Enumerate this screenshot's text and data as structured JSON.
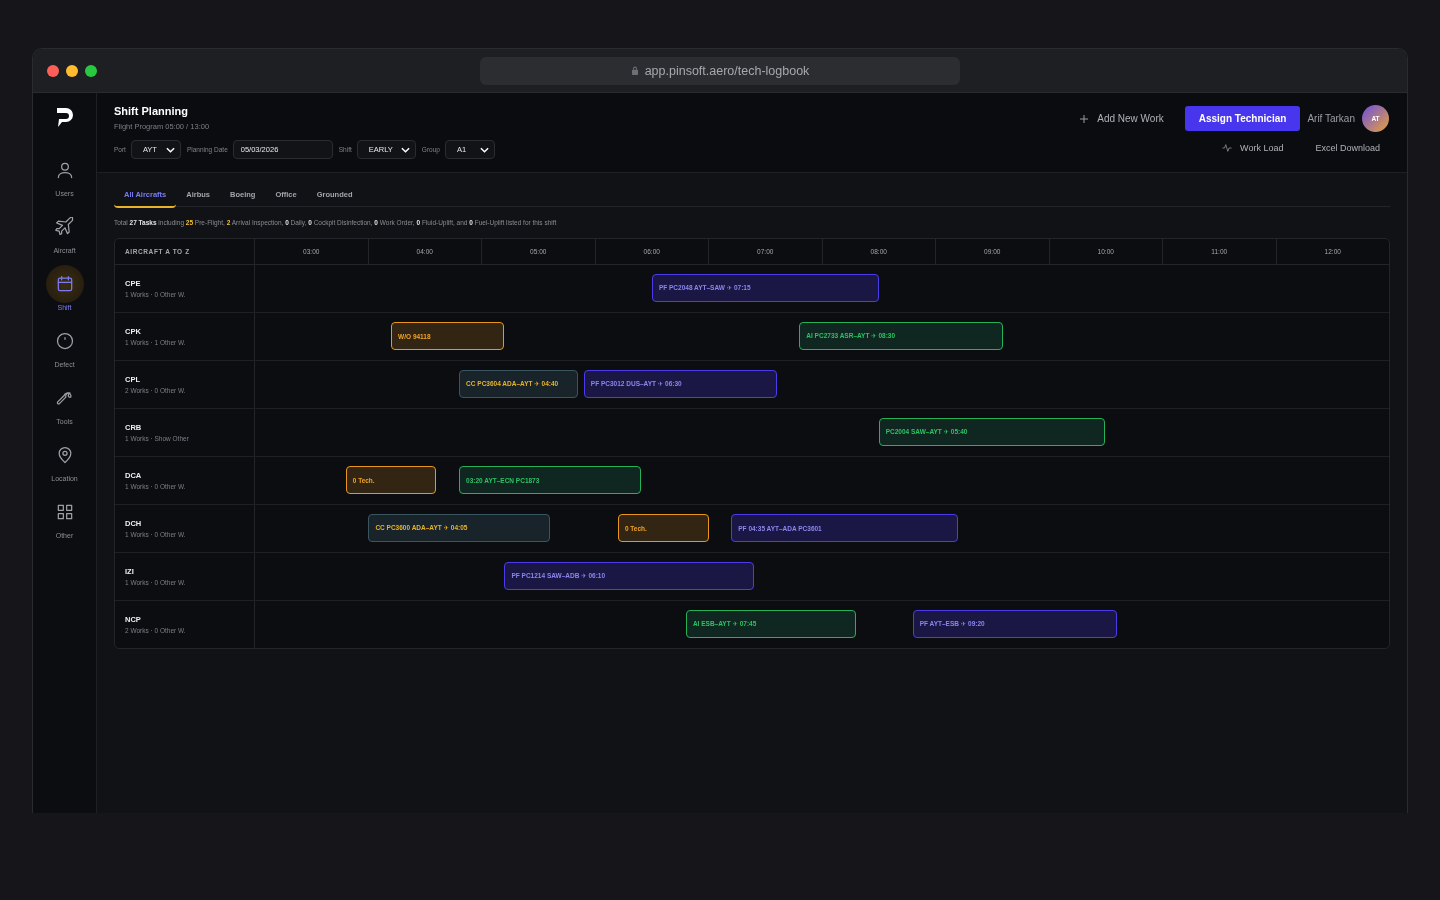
{
  "browser": {
    "url": "app.pinsoft.aero/tech-logbook"
  },
  "sidebar": {
    "items": [
      {
        "label": "Users",
        "selected": false
      },
      {
        "label": "Aircraft",
        "selected": false
      },
      {
        "label": "Shift",
        "selected": true
      },
      {
        "label": "Defect",
        "selected": false
      },
      {
        "label": "Tools",
        "selected": false
      },
      {
        "label": "Location",
        "selected": false
      },
      {
        "label": "Other",
        "selected": false
      }
    ]
  },
  "header": {
    "title": "Shift Planning",
    "subtitle": "Flight Program 05:00 / 13:00",
    "filters": [
      {
        "label": "Port",
        "kind": "select",
        "value": "AYT"
      },
      {
        "label": "Planning Date",
        "kind": "input",
        "value": "05/03/2026"
      },
      {
        "label": "Shift",
        "kind": "select",
        "value": "EARLY"
      },
      {
        "label": "Group",
        "kind": "select",
        "value": "A1"
      }
    ],
    "add_work": "Add New Work",
    "assign_button": "Assign Technician",
    "user_name": "Arif Tarkan",
    "avatar": "AT",
    "work_load": "Work Load",
    "excel_download": "Excel Download"
  },
  "tabs": [
    {
      "label": "All Aircrafts",
      "selected": true
    },
    {
      "label": "Airbus",
      "selected": false
    },
    {
      "label": "Boeing",
      "selected": false
    },
    {
      "label": "Office",
      "selected": false
    },
    {
      "label": "Grounded",
      "selected": false
    }
  ],
  "summary": [
    {
      "text": "Total ",
      "kind": "plain"
    },
    {
      "text": "27 Tasks",
      "kind": "bold"
    },
    {
      "text": " including ",
      "kind": "plain"
    },
    {
      "text": "25",
      "kind": "accent"
    },
    {
      "text": " Pre-Flight, ",
      "kind": "plain"
    },
    {
      "text": "2",
      "kind": "accent"
    },
    {
      "text": " Arrival Inspection, ",
      "kind": "plain"
    },
    {
      "text": "0",
      "kind": "bold"
    },
    {
      "text": " Daily, ",
      "kind": "plain"
    },
    {
      "text": "0",
      "kind": "bold"
    },
    {
      "text": " Cockpit Disinfection, ",
      "kind": "plain"
    },
    {
      "text": "0",
      "kind": "bold"
    },
    {
      "text": " Work Order, ",
      "kind": "plain"
    },
    {
      "text": "0",
      "kind": "bold"
    },
    {
      "text": " Fluid-Uplift, and ",
      "kind": "plain"
    },
    {
      "text": "0",
      "kind": "bold"
    },
    {
      "text": " Fuel-Uplift listed for this shift",
      "kind": "plain"
    }
  ],
  "table": {
    "first_column": "AIRCRAFT A TO Z",
    "hours": [
      "03:00",
      "04:00",
      "05:00",
      "06:00",
      "07:00",
      "08:00",
      "09:00",
      "10:00",
      "11:00",
      "12:00"
    ],
    "rows": [
      {
        "aircraft": "CPE",
        "info": "1 Works · 0 Other W.",
        "bars": [
          {
            "kind": "pf",
            "label": "PF PC2048 AYT–SAW ✈ 07:15"
          }
        ]
      },
      {
        "aircraft": "CPK",
        "info": "1 Works · 1 Other W.",
        "bars": [
          {
            "kind": "wo",
            "label": "W/O 94118"
          },
          {
            "kind": "ai",
            "label": "AI PC2733 ASR–AYT ✈ 08:30"
          }
        ]
      },
      {
        "aircraft": "CPL",
        "info": "2 Works · 0 Other W.",
        "bars": [
          {
            "kind": "cc",
            "label": "CC PC3604 ADA–AYT ✈ 04:40"
          },
          {
            "kind": "pf",
            "label": "PF PC3012 DUS–AYT ✈ 06:30"
          }
        ]
      },
      {
        "aircraft": "CRB",
        "info": "1 Works · Show Other",
        "bars": [
          {
            "kind": "ai",
            "label": "PC2004 SAW–AYT ✈ 05:40"
          }
        ]
      },
      {
        "aircraft": "DCA",
        "info": "1 Works · 0 Other W.",
        "bars": [
          {
            "kind": "wo",
            "label": "0 Tech."
          },
          {
            "kind": "ai",
            "label": "03:20 AYT–ECN PC1873"
          }
        ]
      },
      {
        "aircraft": "DCH",
        "info": "1 Works · 0 Other W.",
        "bars": [
          {
            "kind": "cc",
            "label": "CC PC3600 ADA–AYT ✈ 04:05"
          },
          {
            "kind": "wo",
            "label": "0 Tech."
          },
          {
            "kind": "pf",
            "label": "PF 04:35 AYT–ADA PC3601"
          }
        ]
      },
      {
        "aircraft": "IZI",
        "info": "1 Works · 0 Other W.",
        "bars": [
          {
            "kind": "pf",
            "label": "PF PC1214 SAW–ADB ✈ 06:10"
          }
        ]
      },
      {
        "aircraft": "NCP",
        "info": "2 Works · 0 Other W.",
        "bars": [
          {
            "kind": "ai",
            "label": "AI ESB–AYT ✈ 07:45"
          },
          {
            "kind": "pf",
            "label": "PF AYT–ESB ✈ 09:20"
          }
        ]
      }
    ]
  }
}
